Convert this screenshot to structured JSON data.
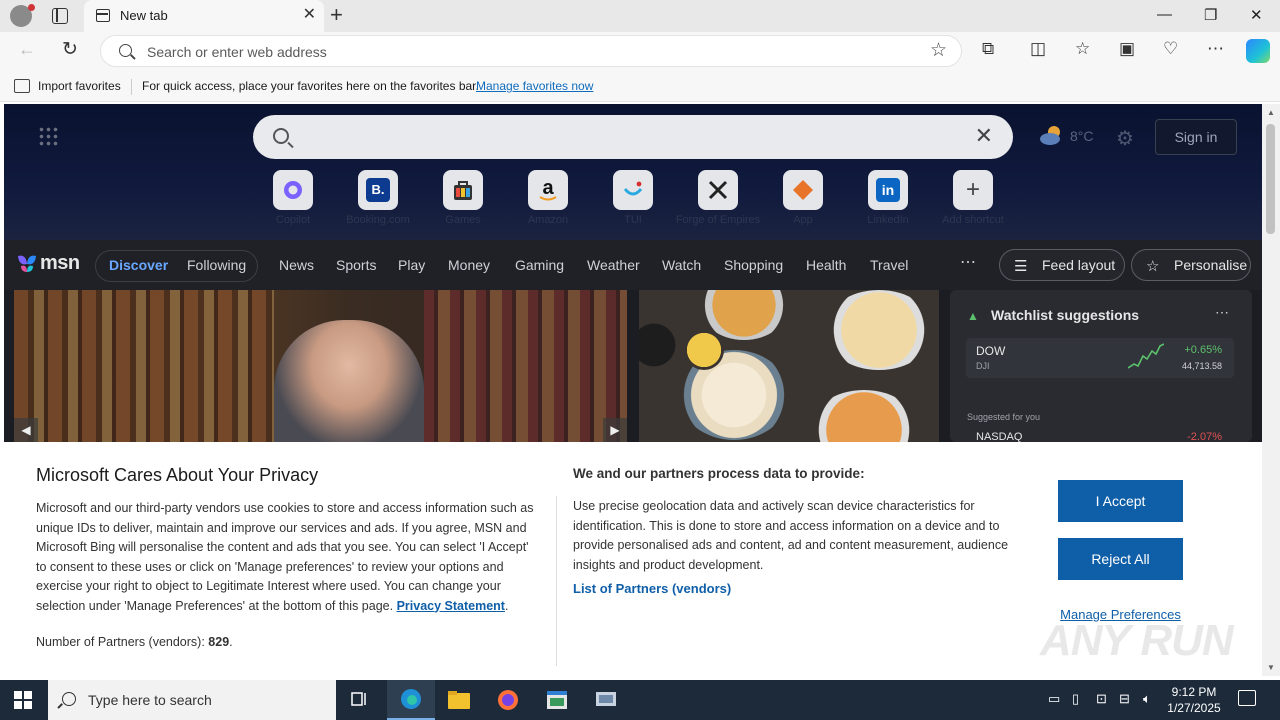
{
  "browser": {
    "tab_title": "New tab",
    "address_placeholder": "Search or enter web address"
  },
  "favorites_bar": {
    "import_label": "Import favorites",
    "hint": "For quick access, place your favorites here on the favorites bar.",
    "manage_link": "Manage favorites now"
  },
  "msn": {
    "search_value": "",
    "weather_temp": "8°C",
    "sign_in": "Sign in",
    "quick_links": [
      {
        "name": "copilot",
        "label": "Copilot"
      },
      {
        "name": "booking",
        "label": "Booking.com"
      },
      {
        "name": "microsoft-start",
        "label": "Games"
      },
      {
        "name": "amazon",
        "label": "Amazon"
      },
      {
        "name": "tui",
        "label": "TUI"
      },
      {
        "name": "forge-of-empires",
        "label": "Forge of Empires"
      },
      {
        "name": "app",
        "label": "App"
      },
      {
        "name": "linkedin",
        "label": "LinkedIn"
      },
      {
        "name": "add",
        "label": "Add shortcut"
      }
    ],
    "logo": "msn",
    "segments": {
      "discover": "Discover",
      "following": "Following"
    },
    "nav": [
      "News",
      "Sports",
      "Play",
      "Money",
      "Gaming",
      "Weather",
      "Watch",
      "Shopping",
      "Health",
      "Travel"
    ],
    "feed_layout": "Feed layout",
    "personalise": "Personalise",
    "watchlist": {
      "title": "Watchlist suggestions",
      "rows": [
        {
          "symbol": "DOW",
          "exchange": "DJI",
          "change": "+0.65%",
          "price": "44,713.58"
        }
      ],
      "suggested": "Suggested for you",
      "row2": {
        "symbol": "NASDAQ",
        "change": "-2.07%"
      }
    }
  },
  "privacy": {
    "title": "Microsoft Cares About Your Privacy",
    "body": "Microsoft and our third-party vendors use cookies to store and access information such as unique IDs to deliver, maintain and improve our services and ads. If you agree, MSN and Microsoft Bing will personalise the content and ads that you see. You can select 'I Accept' to consent to these uses or click on 'Manage preferences' to review your options and exercise your right to object to Legitimate Interest where used.  You can change your selection under 'Manage Preferences' at the bottom of this page.",
    "privacy_link": "Privacy Statement",
    "partners_label": "Number of Partners (vendors):",
    "partners_count": "829",
    "right_title": "We and our partners process data to provide:",
    "right_body": "Use precise geolocation data and actively scan device characteristics for identification. This is done to store and access information on a device and to provide personalised ads and content, ad and content measurement, audience insights and product development.",
    "partners_link": "List of Partners (vendors)",
    "accept": "I Accept",
    "reject": "Reject All",
    "manage": "Manage Preferences"
  },
  "watermark": "ANY RUN",
  "taskbar": {
    "search_placeholder": "Type here to search",
    "time": "9:12 PM",
    "date": "1/27/2025"
  },
  "colors": {
    "accent": "#0f5fa8",
    "msn_dark": "#1c1d22",
    "taskbar": "#1c2a3a"
  }
}
